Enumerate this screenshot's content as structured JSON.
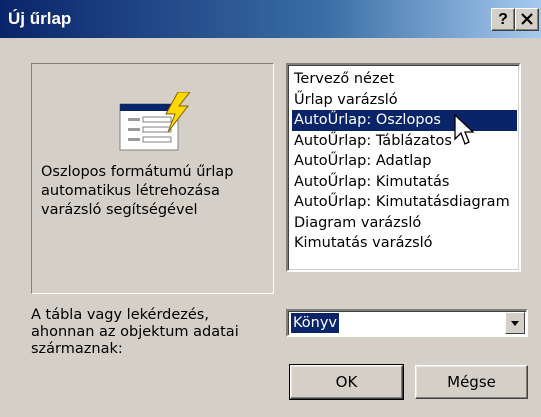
{
  "window": {
    "title": "Új űrlap",
    "help_label": "?",
    "close_label": "×"
  },
  "preview": {
    "icon": "form-wizard-icon",
    "description_lines": [
      "Oszlopos formátumú űrlap",
      "automatikus létrehozása",
      "varázsló segítségével"
    ]
  },
  "list": {
    "items": [
      "Tervező nézet",
      "Űrlap varázsló",
      "AutoŰrlap: Oszlopos",
      "AutoŰrlap: Táblázatos",
      "AutoŰrlap: Adatlap",
      "AutoŰrlap:  Kimutatás",
      "AutoŰrlap:  Kimutatásdiagram",
      "Diagram varázsló",
      "Kimutatás varázsló"
    ],
    "selected": "AutoŰrlap: Oszlopos"
  },
  "source": {
    "label_lines": [
      "A tábla vagy lekérdezés,",
      "ahonnan az objektum adatai",
      "származnak:"
    ],
    "value": "Könyv"
  },
  "buttons": {
    "ok": "OK",
    "cancel": "Mégse"
  },
  "colors": {
    "titlebar": "#0a246a",
    "selection": "#0a246a",
    "face": "#d4d0c8"
  }
}
